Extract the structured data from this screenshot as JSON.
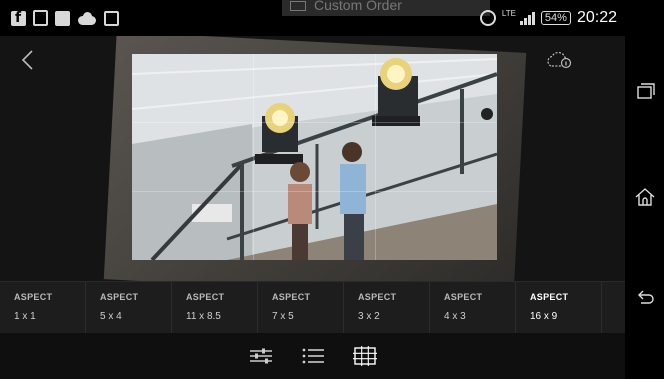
{
  "status_bar": {
    "notification_icons": [
      "facebook-icon",
      "document-icon",
      "image-icon",
      "cloud-icon",
      "mail-icon"
    ],
    "background_app_title": "Custom Order",
    "network_label": "LTE",
    "battery": "54%",
    "time": "20:22"
  },
  "editor": {
    "back_icon": "chevron-left-icon",
    "cloud_icon": "cloud-info-icon"
  },
  "aspect_options": [
    {
      "label": "ASPECT",
      "value": "1 x 1"
    },
    {
      "label": "ASPECT",
      "value": "5 x 4"
    },
    {
      "label": "ASPECT",
      "value": "11 x 8.5"
    },
    {
      "label": "ASPECT",
      "value": "7 x 5"
    },
    {
      "label": "ASPECT",
      "value": "3 x 2"
    },
    {
      "label": "ASPECT",
      "value": "4 x 3"
    },
    {
      "label": "ASPECT",
      "value": "16 x 9"
    }
  ],
  "selected_aspect": "16 x 9",
  "toolbar": {
    "tools": [
      "adjust-sliders-icon",
      "list-icon",
      "crop-grid-icon"
    ]
  },
  "nav_bar": {
    "buttons": [
      "recent-apps-icon",
      "home-icon",
      "back-icon"
    ]
  },
  "colors": {
    "active_text": "#ffffff",
    "inactive_text": "#b9b9b9",
    "bar_background": "#1d1d1d"
  }
}
